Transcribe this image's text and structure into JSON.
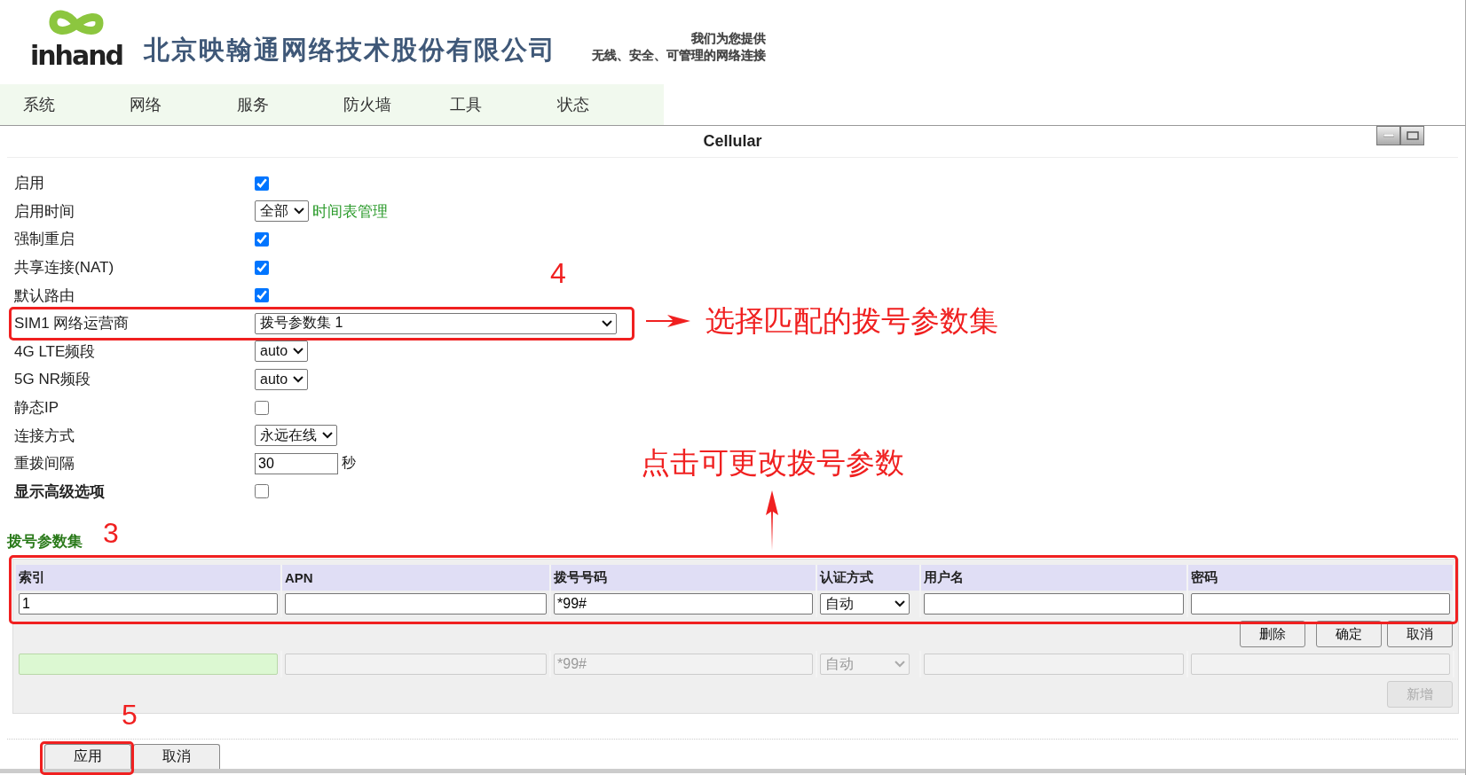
{
  "header": {
    "logo_text": "inhand",
    "company_name": "北京映翰通网络技术股份有限公司",
    "slogan": [
      "我们为您提供",
      "无线、安全、可管理的网络连接"
    ]
  },
  "nav": {
    "items": [
      {
        "label": "系统"
      },
      {
        "label": "网络"
      },
      {
        "label": "服务"
      },
      {
        "label": "防火墙"
      },
      {
        "label": "工具"
      },
      {
        "label": "状态"
      }
    ]
  },
  "panel": {
    "title": "Cellular"
  },
  "form": {
    "rows": [
      {
        "kind": "checkbox",
        "label": "启用",
        "strong": false,
        "checked": true
      },
      {
        "kind": "select",
        "label": "启用时间",
        "strong": false,
        "value": "全部",
        "link": "时间表管理"
      },
      {
        "kind": "checkbox",
        "label": "强制重启",
        "strong": false,
        "checked": true
      },
      {
        "kind": "checkbox",
        "label": "共享连接(NAT)",
        "strong": false,
        "checked": true
      },
      {
        "kind": "checkbox",
        "label": "默认路由",
        "strong": false,
        "checked": true
      },
      {
        "kind": "wide_select",
        "label": "SIM1 网络运营商",
        "strong": false,
        "value": "拨号参数集 1"
      },
      {
        "kind": "select",
        "label": "4G LTE频段",
        "strong": false,
        "value": "auto"
      },
      {
        "kind": "select",
        "label": "5G NR频段",
        "strong": false,
        "value": "auto"
      },
      {
        "kind": "checkbox",
        "label": "静态IP",
        "strong": false,
        "checked": false
      },
      {
        "kind": "select",
        "label": "连接方式",
        "strong": false,
        "value": "永远在线"
      },
      {
        "kind": "text",
        "label": "重拨间隔",
        "strong": false,
        "value": "30",
        "unit": "秒"
      },
      {
        "kind": "checkbox",
        "label": "显示高级选项",
        "strong": true,
        "checked": false
      }
    ]
  },
  "dial_sets": {
    "title": "拨号参数集",
    "columns": [
      "索引",
      "APN",
      "拨号号码",
      "认证方式",
      "用户名",
      "密码"
    ],
    "edit_row": {
      "index": "1",
      "number": "*99#",
      "auth": "自动"
    },
    "edit_buttons": [
      "删除",
      "确定",
      "取消"
    ],
    "new_row": {
      "number": "*99#",
      "auth": "自动"
    },
    "add_button": {
      "label": "新增",
      "disabled": true
    }
  },
  "footer": {
    "buttons": [
      "应用",
      "取消"
    ]
  },
  "annotations": [
    {
      "kind": "step",
      "text": "4"
    },
    {
      "kind": "note",
      "text": "选择匹配的拨号参数集"
    },
    {
      "kind": "note",
      "text": "点击可更改拨号参数"
    },
    {
      "kind": "step",
      "text": "3"
    },
    {
      "kind": "step",
      "text": "5"
    }
  ]
}
